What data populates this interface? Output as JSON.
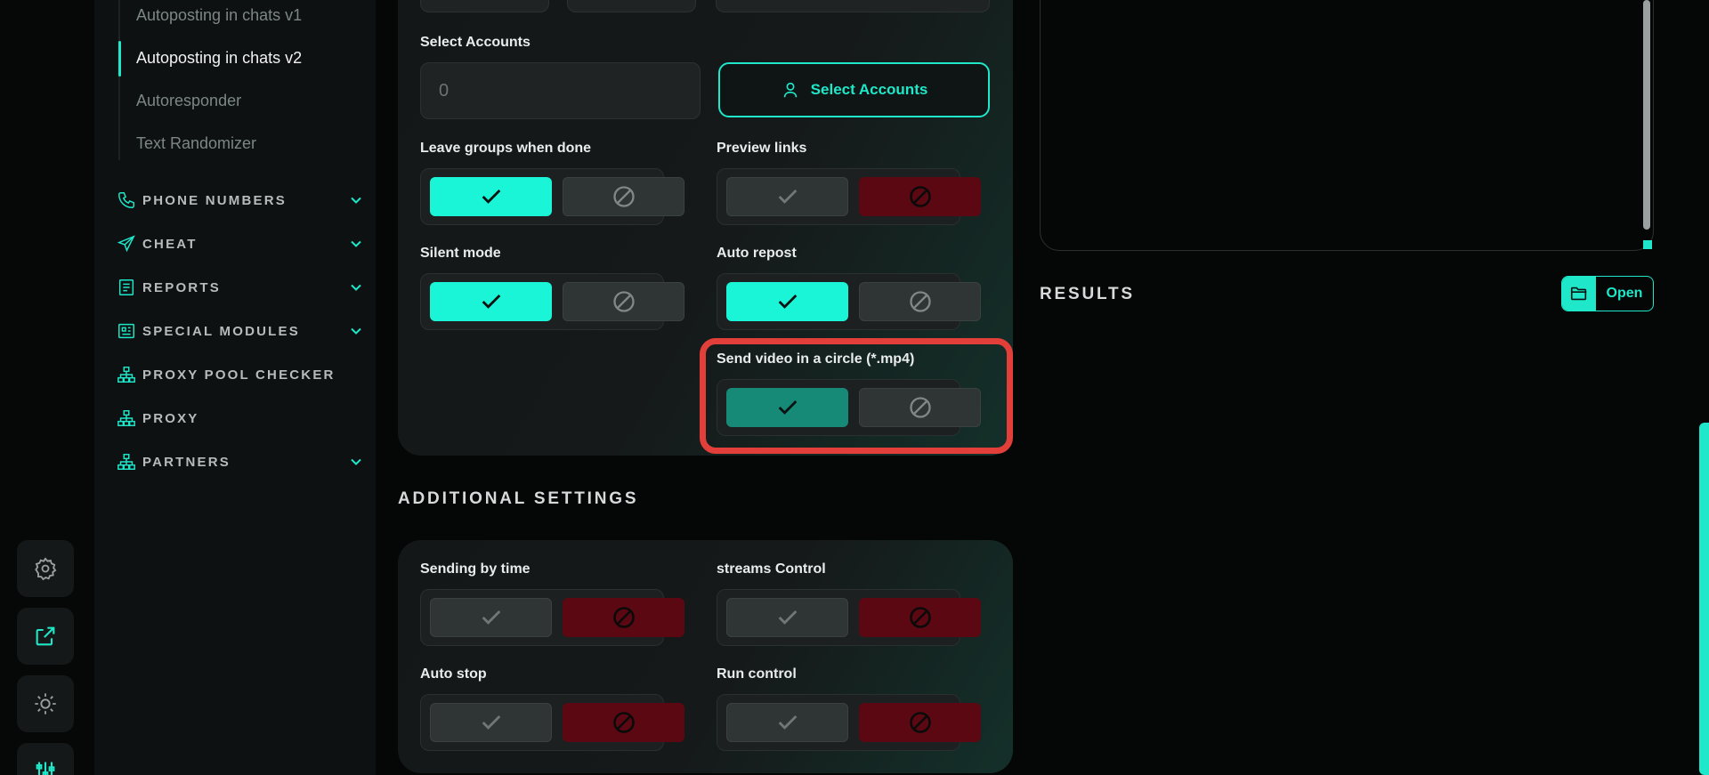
{
  "sidebar": {
    "sub_items": [
      {
        "label": "Autoposting in chats v1"
      },
      {
        "label": "Autoposting in chats v2"
      },
      {
        "label": "Autoresponder"
      },
      {
        "label": "Text Randomizer"
      }
    ],
    "nav_items": [
      {
        "label": "PHONE NUMBERS",
        "icon": "phone-icon"
      },
      {
        "label": "CHEAT",
        "icon": "send-icon"
      },
      {
        "label": "REPORTS",
        "icon": "report-icon"
      },
      {
        "label": "SPECIAL MODULES",
        "icon": "modules-icon"
      },
      {
        "label": "PROXY POOL CHECKER",
        "icon": "network-icon"
      },
      {
        "label": "PROXY",
        "icon": "network-icon"
      },
      {
        "label": "PARTNERS",
        "icon": "network-icon"
      }
    ]
  },
  "main": {
    "select_accounts_label": "Select Accounts",
    "account_count": "0",
    "select_accounts_button": "Select Accounts",
    "toggles": {
      "leave_groups": {
        "label": "Leave groups when done",
        "state": "on"
      },
      "preview_links": {
        "label": "Preview links",
        "state": "off"
      },
      "silent_mode": {
        "label": "Silent mode",
        "state": "on"
      },
      "auto_repost": {
        "label": "Auto repost",
        "state": "on"
      },
      "send_video_circle": {
        "label": "Send video in a circle (*.mp4)",
        "state": "on"
      }
    },
    "additional_title": "ADDITIONAL SETTINGS",
    "additional_toggles": {
      "sending_by_time": {
        "label": "Sending by time",
        "state": "off"
      },
      "streams_control": {
        "label": "streams Control",
        "state": "off"
      },
      "auto_stop": {
        "label": "Auto stop",
        "state": "off"
      },
      "run_control": {
        "label": "Run control",
        "state": "off"
      }
    }
  },
  "results": {
    "title": "RESULTS",
    "open_button": "Open"
  },
  "colors": {
    "accent": "#1ee8c9",
    "toggle_on": "#19f5d6",
    "toggle_off_red": "#5b0812",
    "highlight": "#e23f3a"
  }
}
